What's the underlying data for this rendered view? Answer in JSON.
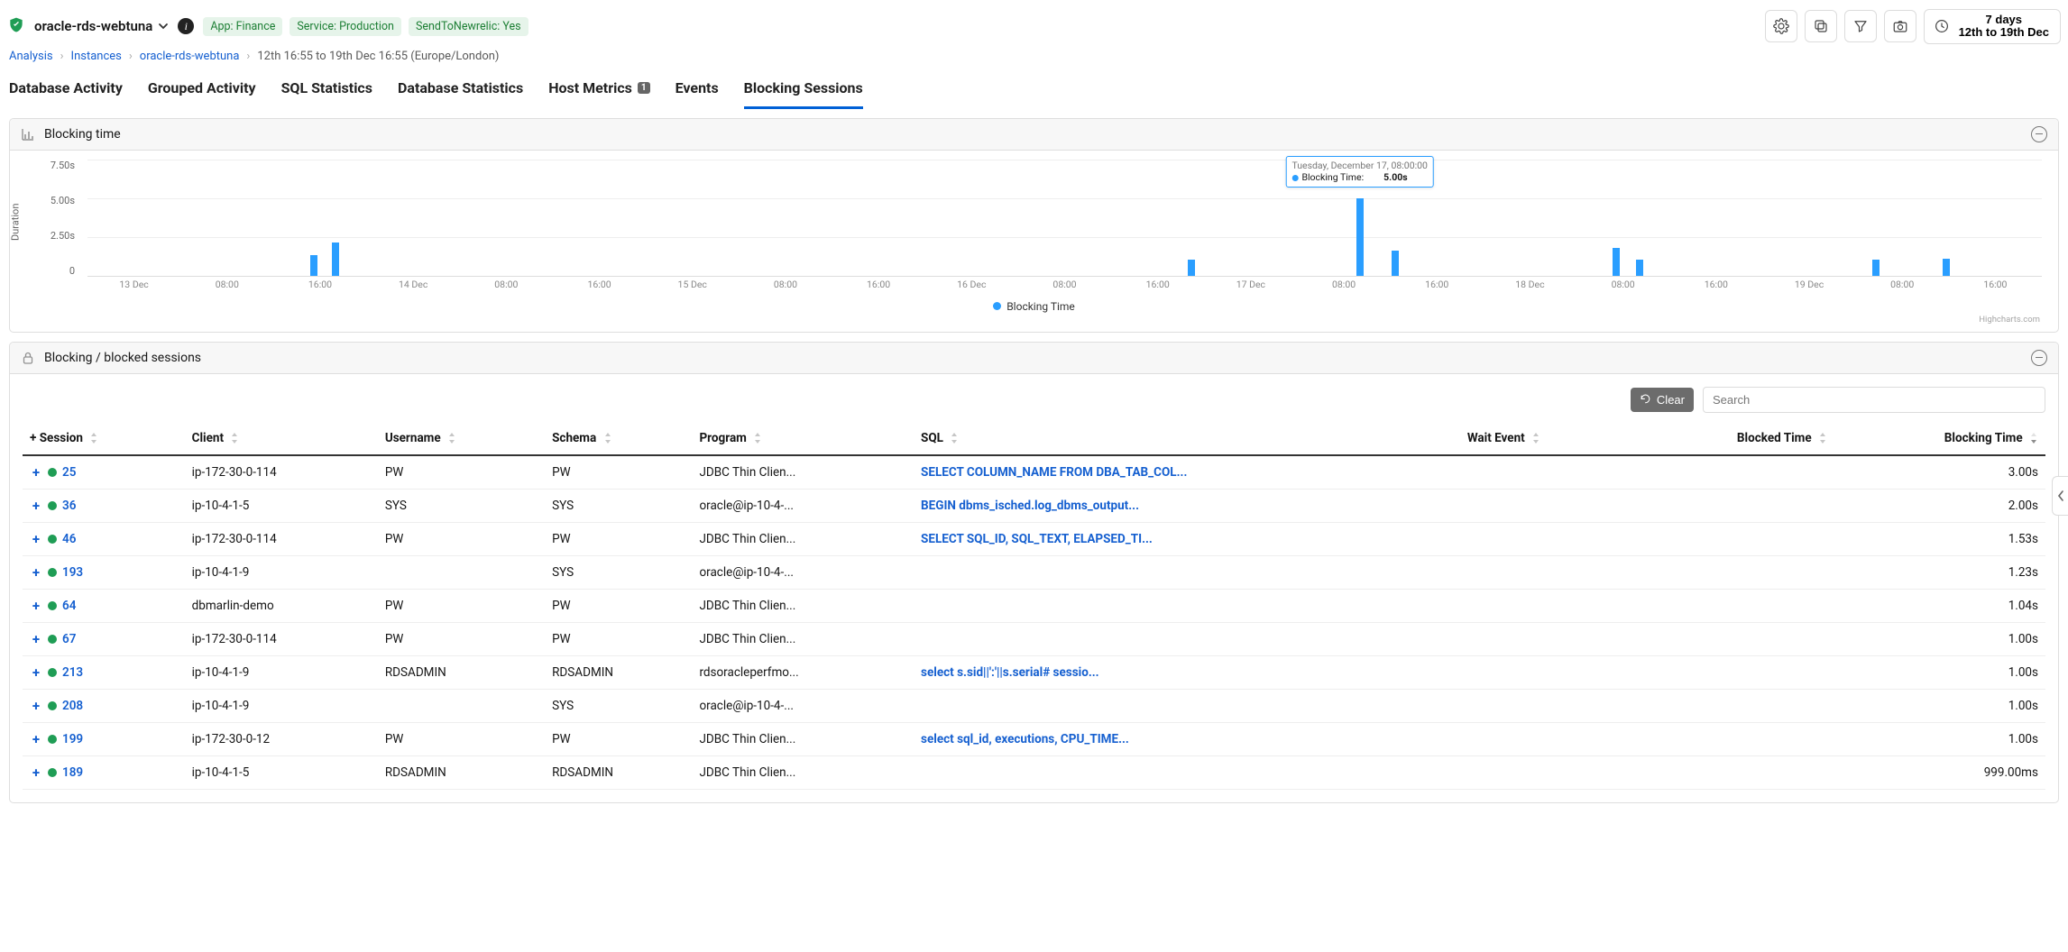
{
  "header": {
    "title": "oracle-rds-webtuna",
    "badges": [
      "App: Finance",
      "Service: Production",
      "SendToNewrelic: Yes"
    ],
    "time_button": {
      "line1": "7 days",
      "line2": "12th to 19th Dec"
    }
  },
  "breadcrumb": {
    "items": [
      "Analysis",
      "Instances",
      "oracle-rds-webtuna"
    ],
    "tail": "12th 16:55 to 19th Dec 16:55 (Europe/London)"
  },
  "tabs": [
    {
      "label": "Database Activity",
      "active": false,
      "badge": null
    },
    {
      "label": "Grouped Activity",
      "active": false,
      "badge": null
    },
    {
      "label": "SQL Statistics",
      "active": false,
      "badge": null
    },
    {
      "label": "Database Statistics",
      "active": false,
      "badge": null
    },
    {
      "label": "Host Metrics",
      "active": false,
      "badge": "1"
    },
    {
      "label": "Events",
      "active": false,
      "badge": null
    },
    {
      "label": "Blocking Sessions",
      "active": true,
      "badge": null
    }
  ],
  "panels": {
    "chart": {
      "title": "Blocking time"
    },
    "sessions": {
      "title": "Blocking / blocked sessions"
    }
  },
  "chart_data": {
    "type": "bar",
    "title": "Blocking time",
    "ylabel": "Duration",
    "y_ticks": [
      "7.50s",
      "5.00s",
      "2.50s",
      "0"
    ],
    "ylim_seconds": [
      0,
      7.5
    ],
    "x_ticks": [
      "13 Dec",
      "08:00",
      "16:00",
      "14 Dec",
      "08:00",
      "16:00",
      "15 Dec",
      "08:00",
      "16:00",
      "16 Dec",
      "08:00",
      "16:00",
      "17 Dec",
      "08:00",
      "16:00",
      "18 Dec",
      "08:00",
      "16:00",
      "19 Dec",
      "08:00",
      "16:00"
    ],
    "legend": "Blocking Time",
    "credit": "Highcharts.com",
    "bars": [
      {
        "x_pct": 11.6,
        "value_s": 1.3
      },
      {
        "x_pct": 12.7,
        "value_s": 2.1
      },
      {
        "x_pct": 56.5,
        "value_s": 1.0
      },
      {
        "x_pct": 65.1,
        "value_s": 5.0
      },
      {
        "x_pct": 66.9,
        "value_s": 1.6
      },
      {
        "x_pct": 78.2,
        "value_s": 1.8
      },
      {
        "x_pct": 79.4,
        "value_s": 1.0
      },
      {
        "x_pct": 91.5,
        "value_s": 1.0
      },
      {
        "x_pct": 95.1,
        "value_s": 1.1
      }
    ],
    "tooltip": {
      "x_pct": 65.1,
      "date": "Tuesday, December 17, 08:00:00",
      "series": "Blocking Time:",
      "value": "5.00s"
    }
  },
  "table": {
    "clear_label": "Clear",
    "search_placeholder": "Search",
    "columns": {
      "session_expand_all": "+",
      "session": "Session",
      "client": "Client",
      "username": "Username",
      "schema": "Schema",
      "program": "Program",
      "sql": "SQL",
      "wait_event": "Wait Event",
      "blocked_time": "Blocked Time",
      "blocking_time": "Blocking Time"
    },
    "rows": [
      {
        "session": "25",
        "client": "ip-172-30-0-114",
        "username": "PW",
        "schema": "PW",
        "program": "JDBC Thin Clien...",
        "sql": "SELECT COLUMN_NAME FROM DBA_TAB_COL...",
        "wait_event": "",
        "blocked_time": "",
        "blocking_time": "3.00s"
      },
      {
        "session": "36",
        "client": "ip-10-4-1-5",
        "username": "SYS",
        "schema": "SYS",
        "program": "oracle@ip-10-4-...",
        "sql": "BEGIN dbms_isched.log_dbms_output...",
        "wait_event": "",
        "blocked_time": "",
        "blocking_time": "2.00s"
      },
      {
        "session": "46",
        "client": "ip-172-30-0-114",
        "username": "PW",
        "schema": "PW",
        "program": "JDBC Thin Clien...",
        "sql": "SELECT SQL_ID, SQL_TEXT, ELAPSED_TI...",
        "wait_event": "",
        "blocked_time": "",
        "blocking_time": "1.53s"
      },
      {
        "session": "193",
        "client": "ip-10-4-1-9",
        "username": "",
        "schema": "SYS",
        "program": "oracle@ip-10-4-...",
        "sql": "",
        "wait_event": "",
        "blocked_time": "",
        "blocking_time": "1.23s"
      },
      {
        "session": "64",
        "client": "dbmarlin-demo",
        "username": "PW",
        "schema": "PW",
        "program": "JDBC Thin Clien...",
        "sql": "",
        "wait_event": "",
        "blocked_time": "",
        "blocking_time": "1.04s"
      },
      {
        "session": "67",
        "client": "ip-172-30-0-114",
        "username": "PW",
        "schema": "PW",
        "program": "JDBC Thin Clien...",
        "sql": "",
        "wait_event": "",
        "blocked_time": "",
        "blocking_time": "1.00s"
      },
      {
        "session": "213",
        "client": "ip-10-4-1-9",
        "username": "RDSADMIN",
        "schema": "RDSADMIN",
        "program": "rdsoracleperfmo...",
        "sql": "select s.sid||':'||s.serial# sessio...",
        "wait_event": "",
        "blocked_time": "",
        "blocking_time": "1.00s"
      },
      {
        "session": "208",
        "client": "ip-10-4-1-9",
        "username": "",
        "schema": "SYS",
        "program": "oracle@ip-10-4-...",
        "sql": "",
        "wait_event": "",
        "blocked_time": "",
        "blocking_time": "1.00s"
      },
      {
        "session": "199",
        "client": "ip-172-30-0-12",
        "username": "PW",
        "schema": "PW",
        "program": "JDBC Thin Clien...",
        "sql": "select sql_id, executions, CPU_TIME...",
        "wait_event": "",
        "blocked_time": "",
        "blocking_time": "1.00s"
      },
      {
        "session": "189",
        "client": "ip-10-4-1-5",
        "username": "RDSADMIN",
        "schema": "RDSADMIN",
        "program": "JDBC Thin Clien...",
        "sql": "",
        "wait_event": "",
        "blocked_time": "",
        "blocking_time": "999.00ms"
      }
    ]
  }
}
